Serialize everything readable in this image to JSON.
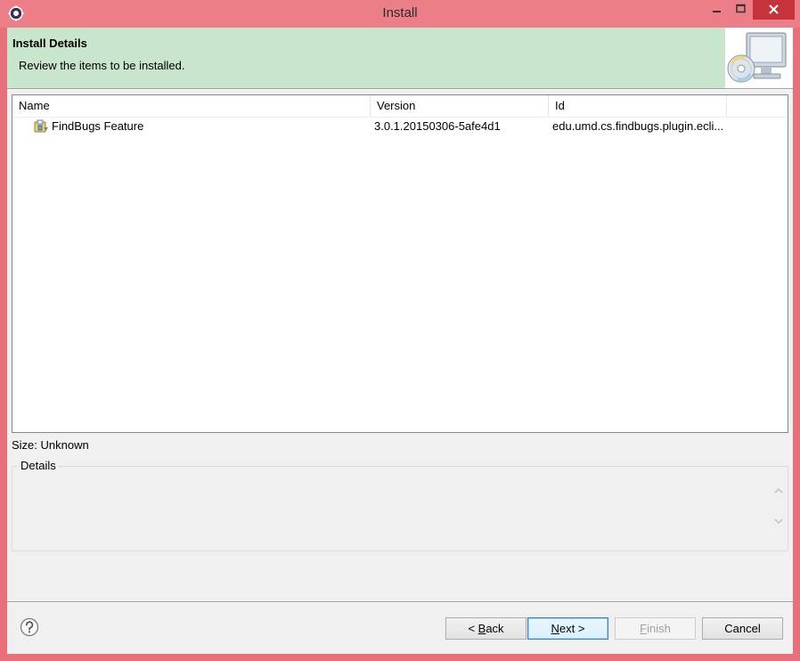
{
  "window": {
    "title": "Install"
  },
  "header": {
    "title": "Install Details",
    "description": "Review the items to be installed."
  },
  "table": {
    "columns": [
      "Name",
      "Version",
      "Id"
    ],
    "rows": [
      {
        "name": "FindBugs Feature",
        "version": "3.0.1.20150306-5afe4d1",
        "id": "edu.umd.cs.findbugs.plugin.ecli..."
      }
    ]
  },
  "size_label": "Size: Unknown",
  "details": {
    "legend": "Details"
  },
  "buttons": {
    "back": {
      "prefix": "< ",
      "mnemonic": "B",
      "rest": "ack"
    },
    "next": {
      "mnemonic": "N",
      "rest": "ext >"
    },
    "finish": {
      "mnemonic": "F",
      "rest": "inish"
    },
    "cancel": "Cancel"
  },
  "icons": {
    "app": "eclipse-gear-icon",
    "header": "install-cd-monitor-icon",
    "feature": "feature-plug-icon",
    "help": "help-question-icon"
  },
  "colors": {
    "titlebar": "#eb7e86",
    "close_button": "#c7333a",
    "header_band": "#c8e6cc",
    "dialog_bg": "#f0f0f0"
  }
}
